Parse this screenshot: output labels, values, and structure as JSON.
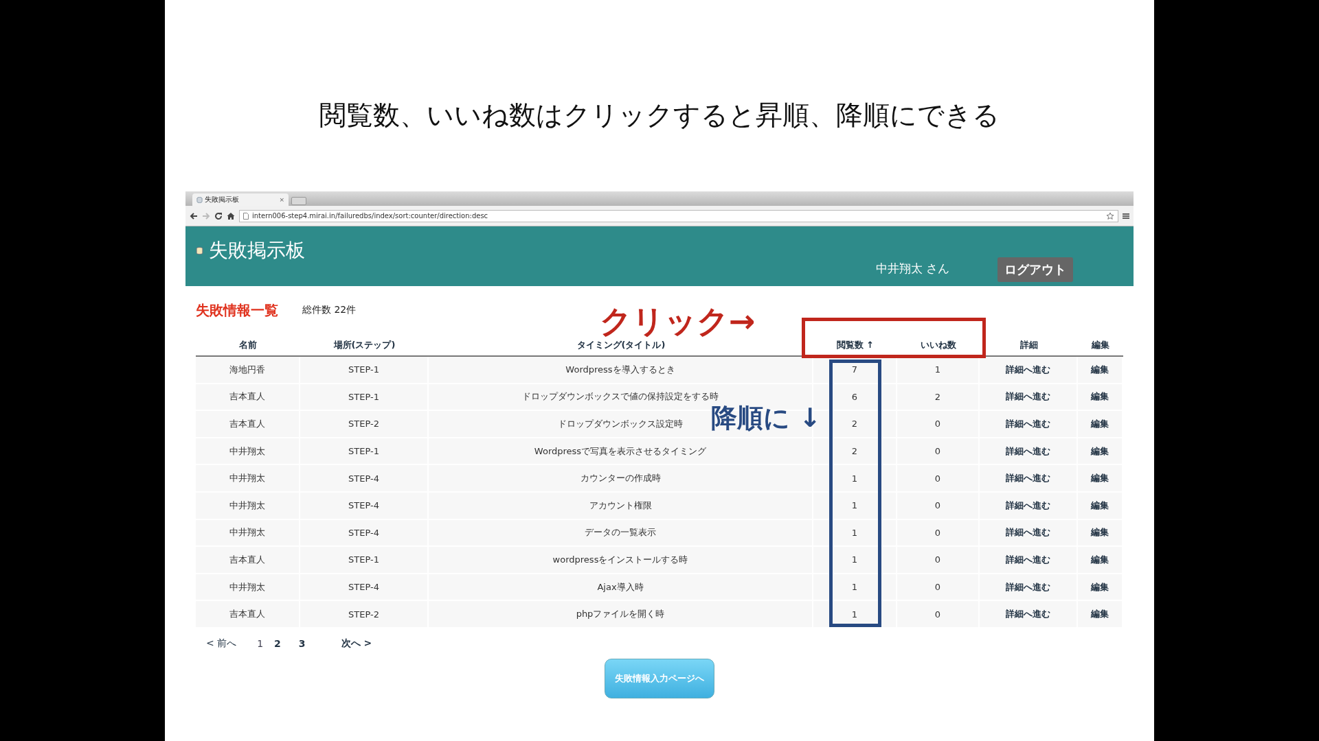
{
  "slide_title": "閲覧数、いいね数はクリックすると昇順、降順にできる",
  "browser": {
    "tab": {
      "title": "失敗掲示板",
      "close": "×"
    },
    "url": "intern006-step4.mirai.in/failuredbs/index/sort:counter/direction:desc"
  },
  "header": {
    "site_title": "失敗掲示板",
    "user": "中井翔太 さん",
    "logout": "ログアウト"
  },
  "list": {
    "heading": "失敗情報一覧",
    "total": "総件数 22件"
  },
  "table": {
    "columns": [
      "名前",
      "場所(ステップ)",
      "タイミング(タイトル)",
      "閲覧数 ↑",
      "いいね数",
      "詳細",
      "編集"
    ],
    "rows": [
      {
        "name": "海地円香",
        "step": "STEP-1",
        "title": "Wordpressを導入するとき",
        "views": "7",
        "likes": "1",
        "detail": "詳細へ進む",
        "edit": "編集"
      },
      {
        "name": "吉本直人",
        "step": "STEP-1",
        "title": "ドロップダウンボックスで値の保持設定をする時",
        "views": "6",
        "likes": "2",
        "detail": "詳細へ進む",
        "edit": "編集"
      },
      {
        "name": "吉本直人",
        "step": "STEP-2",
        "title": "ドロップダウンボックス設定時",
        "views": "2",
        "likes": "0",
        "detail": "詳細へ進む",
        "edit": "編集"
      },
      {
        "name": "中井翔太",
        "step": "STEP-1",
        "title": "Wordpressで写真を表示させるタイミング",
        "views": "2",
        "likes": "0",
        "detail": "詳細へ進む",
        "edit": "編集"
      },
      {
        "name": "中井翔太",
        "step": "STEP-4",
        "title": "カウンターの作成時",
        "views": "1",
        "likes": "0",
        "detail": "詳細へ進む",
        "edit": "編集"
      },
      {
        "name": "中井翔太",
        "step": "STEP-4",
        "title": "アカウント権限",
        "views": "1",
        "likes": "0",
        "detail": "詳細へ進む",
        "edit": "編集"
      },
      {
        "name": "中井翔太",
        "step": "STEP-4",
        "title": "データの一覧表示",
        "views": "1",
        "likes": "0",
        "detail": "詳細へ進む",
        "edit": "編集"
      },
      {
        "name": "吉本直人",
        "step": "STEP-1",
        "title": "wordpressをインストールする時",
        "views": "1",
        "likes": "0",
        "detail": "詳細へ進む",
        "edit": "編集"
      },
      {
        "name": "中井翔太",
        "step": "STEP-4",
        "title": "Ajax導入時",
        "views": "1",
        "likes": "0",
        "detail": "詳細へ進む",
        "edit": "編集"
      },
      {
        "name": "吉本直人",
        "step": "STEP-2",
        "title": "phpファイルを開く時",
        "views": "1",
        "likes": "0",
        "detail": "詳細へ進む",
        "edit": "編集"
      }
    ]
  },
  "pagination": {
    "prev": "< 前へ",
    "pages": [
      {
        "label": "1",
        "selected": true
      },
      {
        "label": "2",
        "selected": false
      },
      {
        "label": "3",
        "selected": false
      }
    ],
    "next": "次へ >"
  },
  "input_button": "失敗情報入力ページへ",
  "annotations": {
    "click_note": "クリック→",
    "desc_note": "降順に ↓"
  }
}
